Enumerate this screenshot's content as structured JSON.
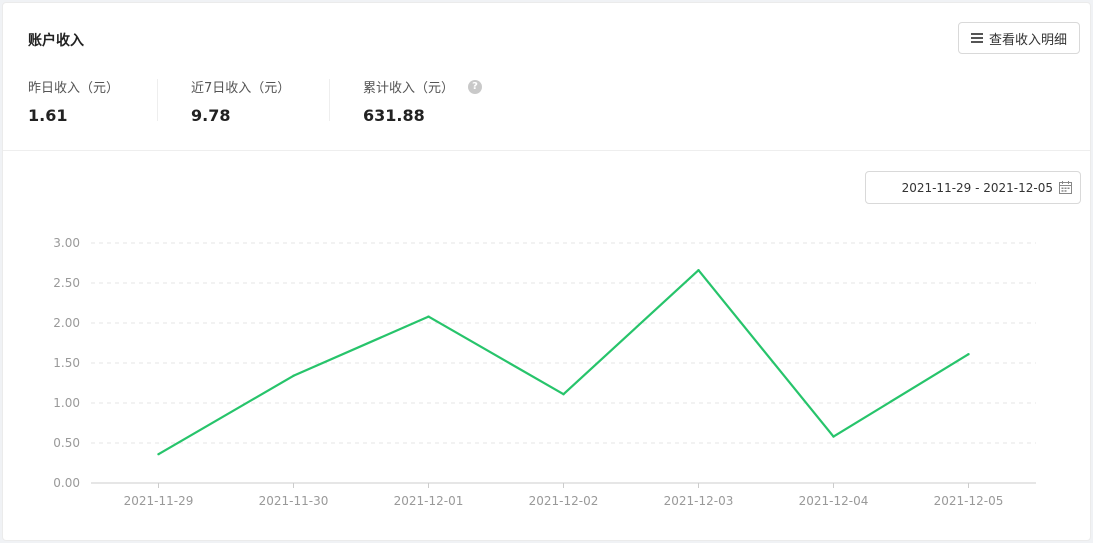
{
  "header": {
    "title": "账户收入",
    "detail_button": "查看收入明细"
  },
  "stats": [
    {
      "label": "昨日收入（元）",
      "value": "1.61"
    },
    {
      "label": "近7日收入（元）",
      "value": "9.78"
    },
    {
      "label": "累计收入（元）",
      "value": "631.88"
    }
  ],
  "date_range": "2021-11-29 - 2021-12-05",
  "chart_data": {
    "type": "line",
    "categories": [
      "2021-11-29",
      "2021-11-30",
      "2021-12-01",
      "2021-12-02",
      "2021-12-03",
      "2021-12-04",
      "2021-12-05"
    ],
    "series": [
      {
        "values": [
          0.36,
          1.34,
          2.08,
          1.11,
          2.66,
          0.58,
          1.61
        ],
        "color": "#27c46b"
      }
    ],
    "ylim": [
      0,
      3
    ],
    "yticks": [
      "0.00",
      "0.50",
      "1.00",
      "1.50",
      "2.00",
      "2.50",
      "3.00"
    ],
    "grid": true
  }
}
